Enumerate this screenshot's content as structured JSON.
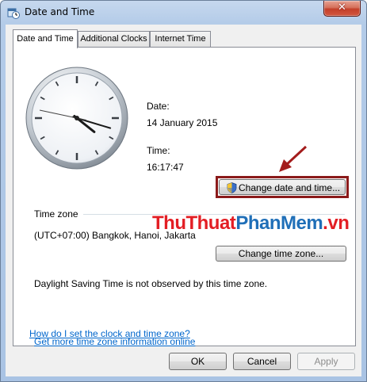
{
  "window": {
    "title": "Date and Time",
    "close_symbol": "✕"
  },
  "tabs": [
    {
      "label": "Date and Time",
      "active": true
    },
    {
      "label": "Additional Clocks",
      "active": false
    },
    {
      "label": "Internet Time",
      "active": false
    }
  ],
  "clock": {
    "hours": 16,
    "minutes": 17,
    "seconds": 47
  },
  "date": {
    "label": "Date:",
    "value": "14 January 2015"
  },
  "time": {
    "label": "Time:",
    "value": "16:17:47"
  },
  "change_datetime_button": "Change date and time...",
  "timezone": {
    "heading": "Time zone",
    "value": "(UTC+07:00) Bangkok, Hanoi, Jakarta",
    "change_button": "Change time zone..."
  },
  "dst_text": "Daylight Saving Time is not observed by this time zone.",
  "links": {
    "more_info": "Get more time zone information online",
    "how_to": "How do I set the clock and time zone?"
  },
  "footer": {
    "ok": "OK",
    "cancel": "Cancel",
    "apply": "Apply"
  },
  "watermark": {
    "part1": "ThuThuat",
    "part2": "PhanMem",
    "part3": ".vn"
  },
  "colors": {
    "annotation_red": "#a31c1c",
    "link_blue": "#0066cc"
  }
}
